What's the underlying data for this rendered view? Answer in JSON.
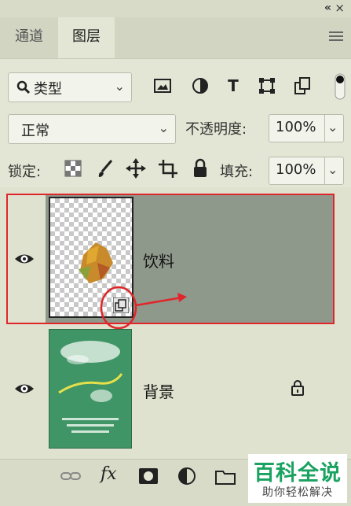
{
  "panel": {
    "tabs": [
      {
        "label": "通道",
        "active": false
      },
      {
        "label": "图层",
        "active": true
      }
    ]
  },
  "filter": {
    "kind_label": "类型",
    "icons": [
      "image-filter-icon",
      "adjustment-filter-icon",
      "type-filter-icon",
      "shape-filter-icon",
      "smart-object-filter-icon",
      "filter-toggle-icon"
    ]
  },
  "blend": {
    "mode": "正常",
    "opacity_label": "不透明度:",
    "opacity_value": "100%"
  },
  "lock": {
    "label": "锁定:",
    "fill_label": "填充:",
    "fill_value": "100%"
  },
  "layers": [
    {
      "name": "饮料",
      "visible": true,
      "selected": true,
      "smart_object": true
    },
    {
      "name": "背景",
      "visible": true,
      "locked": true
    }
  ],
  "footer": {
    "fx_label": "fx"
  },
  "watermark": {
    "title": "百科全说",
    "subtitle": "助你轻松解决"
  },
  "colors": {
    "panel_bg": "#e3e6d4",
    "selected_layer": "#8f998b",
    "annotation_red": "#e0262a",
    "watermark_green": "#1aa260"
  }
}
